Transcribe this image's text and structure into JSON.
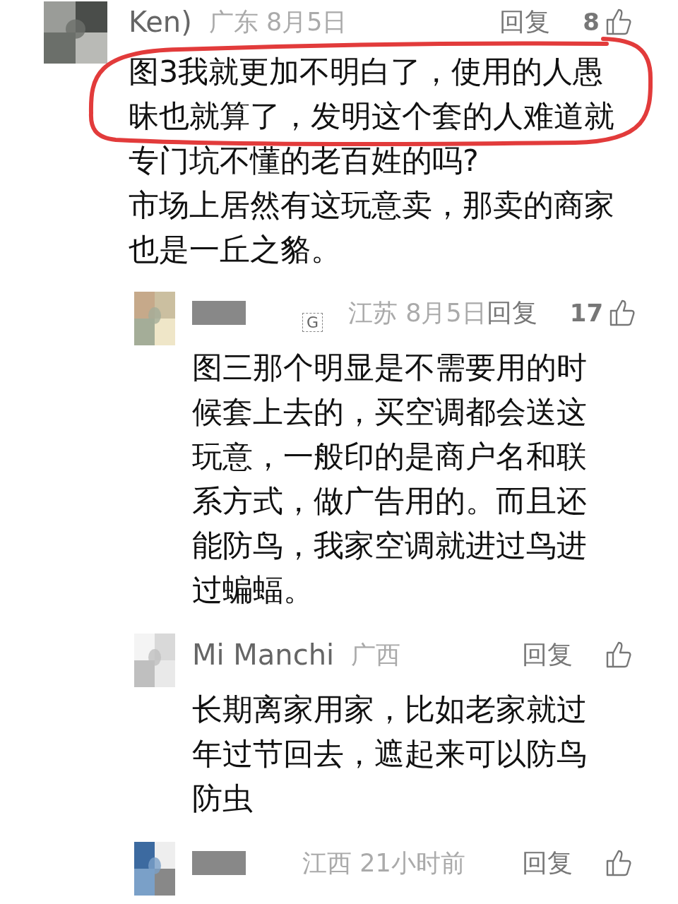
{
  "comments": [
    {
      "name": "Ken)",
      "location": "广东",
      "date": "8月5日",
      "reply": "回复",
      "likes": "8",
      "circled": true,
      "text": "图3我就更加不明白了，使用的人愚昧也就算了，发明这个套的人难道就专门坑不懂的老百姓的吗?\n市场上居然有这玩意卖，那卖的商家也是一丘之貉。",
      "children": [
        {
          "badge": "G",
          "location": "江苏",
          "date": "8月5日",
          "reply": "回复",
          "likes": "17",
          "text": "图三那个明显是不需要用的时候套上去的，买空调都会送这玩意，一般印的是商户名和联系方式，做广告用的。而且还能防鸟，我家空调就进过鸟进过蝙蝠。"
        },
        {
          "name": "Mi Manchi",
          "location": "广西",
          "reply": "回复",
          "text": "长期离家用家，比如老家就过年过节回去，遮起来可以防鸟防虫"
        },
        {
          "location": "江西",
          "date": "21小时前",
          "reply": "回复"
        }
      ]
    }
  ]
}
